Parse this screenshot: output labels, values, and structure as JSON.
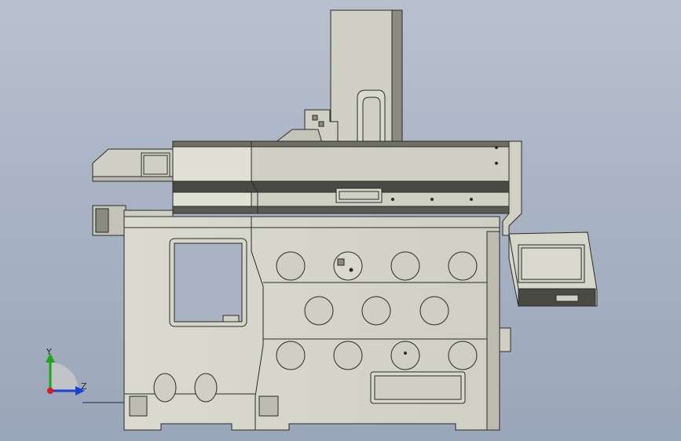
{
  "viewport": {
    "background": "#a9b3c4",
    "body_color": "#d6d6cb",
    "body_shade": "#c8c8bc",
    "stripe_color": "#4a4a44",
    "line_color": "#2b2b2b"
  },
  "triad": {
    "y_label": "Y",
    "z_label": "Z",
    "y_color": "#1aa51a",
    "z_color": "#1c3fd6",
    "x_color": "#d61c1c"
  }
}
